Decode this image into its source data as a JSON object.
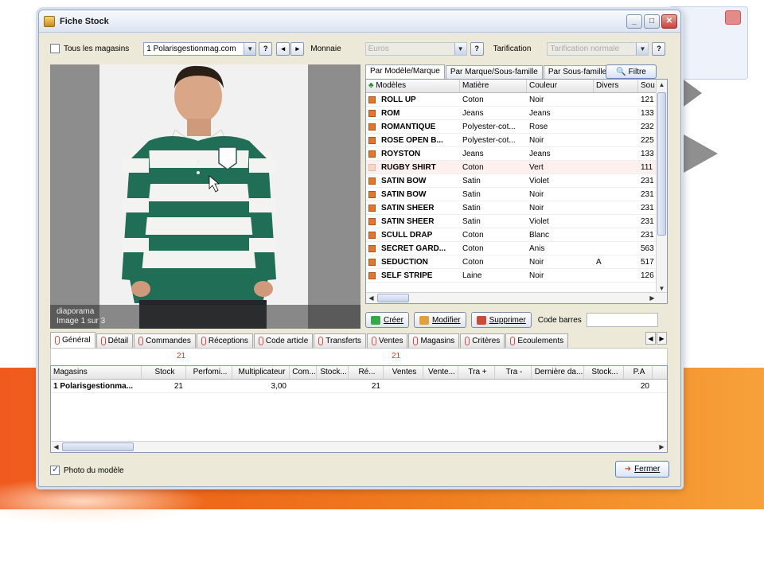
{
  "window": {
    "title": "Fiche Stock"
  },
  "toolbar": {
    "all_stores_label": "Tous les magasins",
    "store_value": "1 Polarisgestionmag.com",
    "currency_label": "Monnaie",
    "currency_value": "Euros",
    "pricing_label": "Tarification",
    "pricing_value": "Tarification normale",
    "help": "?"
  },
  "image": {
    "caption_title": "diaporama",
    "caption_sub": "Image 1 sur 3"
  },
  "right_tabs": [
    "Par Modèle/Marque",
    "Par Marque/Sous-famille",
    "Par Sous-famille/"
  ],
  "filter_label": "Filtre",
  "models": {
    "columns": [
      "Modèles",
      "Matière",
      "Couleur",
      "Divers",
      "Sou"
    ],
    "rows": [
      {
        "model": "ROLL UP",
        "matiere": "Coton",
        "couleur": "Noir",
        "divers": "",
        "sou": "121"
      },
      {
        "model": "ROM",
        "matiere": "Jeans",
        "couleur": "Jeans",
        "divers": "",
        "sou": "133"
      },
      {
        "model": "ROMANTIQUE",
        "matiere": "Polyester-cot...",
        "couleur": "Rose",
        "divers": "",
        "sou": "232"
      },
      {
        "model": "ROSE OPEN B...",
        "matiere": "Polyester-cot...",
        "couleur": "Noir",
        "divers": "",
        "sou": "225"
      },
      {
        "model": "ROYSTON",
        "matiere": "Jeans",
        "couleur": "Jeans",
        "divers": "",
        "sou": "133"
      },
      {
        "model": "RUGBY SHIRT",
        "matiere": "Coton",
        "couleur": "Vert",
        "divers": "",
        "sou": "111"
      },
      {
        "model": "SATIN BOW",
        "matiere": "Satin",
        "couleur": "Violet",
        "divers": "",
        "sou": "231"
      },
      {
        "model": "SATIN BOW",
        "matiere": "Satin",
        "couleur": "Noir",
        "divers": "",
        "sou": "231"
      },
      {
        "model": "SATIN SHEER",
        "matiere": "Satin",
        "couleur": "Noir",
        "divers": "",
        "sou": "231"
      },
      {
        "model": "SATIN SHEER",
        "matiere": "Satin",
        "couleur": "Violet",
        "divers": "",
        "sou": "231"
      },
      {
        "model": "SCULL DRAP",
        "matiere": "Coton",
        "couleur": "Blanc",
        "divers": "",
        "sou": "231"
      },
      {
        "model": "SECRET GARD...",
        "matiere": "Coton",
        "couleur": "Anis",
        "divers": "",
        "sou": "563"
      },
      {
        "model": "SEDUCTION",
        "matiere": "Coton",
        "couleur": "Noir",
        "divers": "A",
        "sou": "517"
      },
      {
        "model": "SELF STRIPE",
        "matiere": "Laine",
        "couleur": "Noir",
        "divers": "",
        "sou": "126"
      }
    ]
  },
  "actions": {
    "create": "Créer",
    "modify": "Modifier",
    "delete": "Supprimer",
    "barcode_label": "Code barres"
  },
  "bottom_tabs": [
    "Général",
    "Détail",
    "Commandes",
    "Réceptions",
    "Code article",
    "Transferts",
    "Ventes",
    "Magasins",
    "Critères",
    "Ecoulements"
  ],
  "summary": {
    "stock_total": "21",
    "re_total": "21"
  },
  "stock_grid": {
    "columns": [
      "Magasins",
      "Stock",
      "Perfomi...",
      "Multiplicateur",
      "Com...",
      "Stock...",
      "Ré...",
      "Ventes",
      "Vente...",
      "Tra +",
      "Tra -",
      "Dernière da...",
      "Stock...",
      "P.A"
    ],
    "rows": [
      {
        "magasin": "1 Polarisgestionma...",
        "stock": "21",
        "perf": "",
        "mult": "3,00",
        "com": "",
        "stock2": "",
        "re": "21",
        "ventes": "",
        "vente2": "",
        "traplus": "",
        "tramoins": "",
        "derniere": "",
        "stock3": "",
        "pa": "20"
      }
    ]
  },
  "footer": {
    "photo_label": "Photo du modèle",
    "close_label": "Fermer"
  }
}
